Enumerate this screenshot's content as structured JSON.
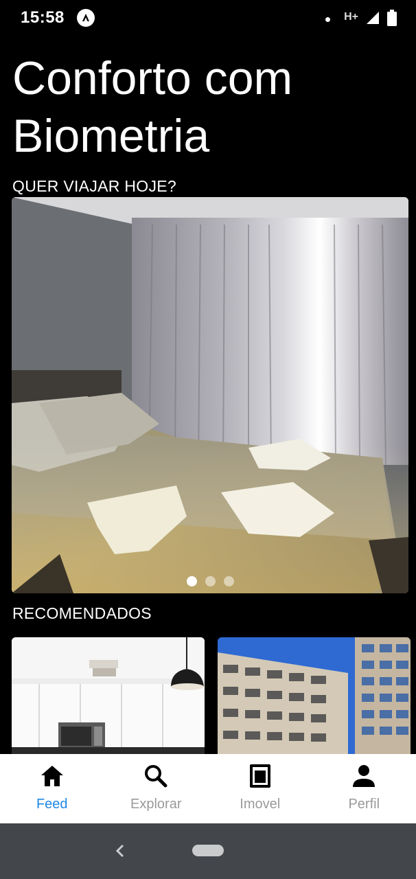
{
  "status_bar": {
    "time": "15:58",
    "network_type": "H+",
    "icons": [
      "app-notification-icon",
      "notification-dot-icon",
      "signal-icon",
      "battery-icon"
    ]
  },
  "header": {
    "title": "Conforto com Biometria"
  },
  "sections": {
    "travel_label": "QUER VIAJAR HOJE?",
    "recommended_label": "RECOMENDADOS"
  },
  "carousel": {
    "slide_count": 3,
    "active_index": 0,
    "image": "bedroom-photo"
  },
  "recommended": [
    {
      "image": "kitchen-photo"
    },
    {
      "image": "building-photo"
    }
  ],
  "tabs": [
    {
      "label": "Feed",
      "icon": "home-icon",
      "active": true
    },
    {
      "label": "Explorar",
      "icon": "search-icon",
      "active": false
    },
    {
      "label": "Imovel",
      "icon": "property-icon",
      "active": false
    },
    {
      "label": "Perfil",
      "icon": "person-icon",
      "active": false
    }
  ],
  "colors": {
    "background": "#000000",
    "accent": "#1e88e5",
    "tab_inactive": "#9a9a9a",
    "nav_bar": "#43474c"
  }
}
